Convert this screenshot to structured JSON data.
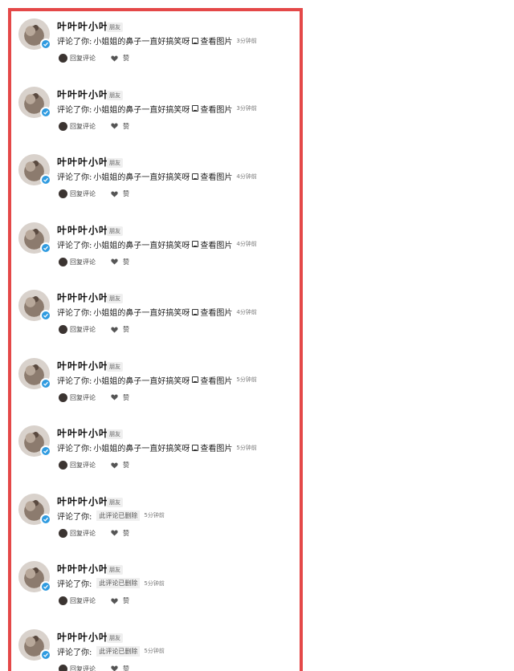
{
  "username": "叶叶叶小叶",
  "tag": "朋友",
  "comment_prefix": "评论了你:",
  "view_image": "查看图片",
  "actions": {
    "reply": "回复评论",
    "like": "赞"
  },
  "colors": {
    "frame": "#e44848",
    "badge": "#2f9be0"
  },
  "icons": [
    "avatar-image",
    "verified-badge-icon",
    "image-icon",
    "heart-icon"
  ],
  "notifications": [
    {
      "type": "comment",
      "quote": "小姐姐的鼻子一直好搞笑呀",
      "time": "3分钟前"
    },
    {
      "type": "comment",
      "quote": "小姐姐的鼻子一直好搞笑呀",
      "time": "3分钟前"
    },
    {
      "type": "comment",
      "quote": "小姐姐的鼻子一直好搞笑呀",
      "time": "4分钟前"
    },
    {
      "type": "comment",
      "quote": "小姐姐的鼻子一直好搞笑呀",
      "time": "4分钟前"
    },
    {
      "type": "comment",
      "quote": "小姐姐的鼻子一直好搞笑呀",
      "time": "4分钟前"
    },
    {
      "type": "comment",
      "quote": "小姐姐的鼻子一直好搞笑呀",
      "time": "5分钟前"
    },
    {
      "type": "comment",
      "quote": "小姐姐的鼻子一直好搞笑呀",
      "time": "5分钟前"
    },
    {
      "type": "deleted",
      "quote": "此评论已删除",
      "time": "5分钟前"
    },
    {
      "type": "deleted",
      "quote": "此评论已删除",
      "time": "5分钟前"
    },
    {
      "type": "deleted",
      "quote": "此评论已删除",
      "time": "5分钟前"
    }
  ]
}
